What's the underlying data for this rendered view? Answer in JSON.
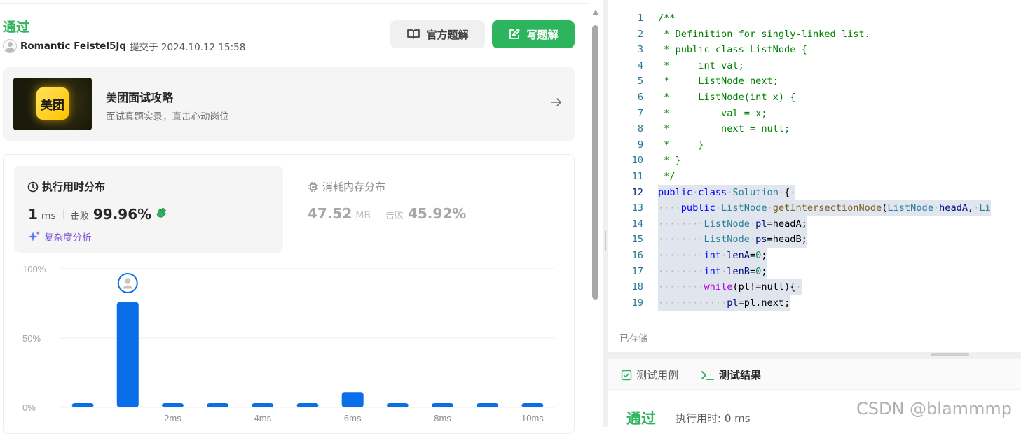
{
  "submission": {
    "status": "通过",
    "user_name": "Romantic Feistel5Jq",
    "submitted_at": "提交于 2024.10.12 15:58",
    "official_solution_label": "官方题解",
    "write_solution_label": "写题解"
  },
  "promo": {
    "logo_text": "美团",
    "title": "美团面试攻略",
    "subtitle": "面试真题实录，直击心动岗位"
  },
  "runtime": {
    "title": "执行用时分布",
    "value": "1",
    "unit": "ms",
    "beat_label": "击败",
    "beat_percent": "99.96%",
    "complexity_label": "复杂度分析"
  },
  "memory": {
    "title": "消耗内存分布",
    "value": "47.52",
    "unit": "MB",
    "beat_label": "击败",
    "beat_percent": "45.92%"
  },
  "chart_data": {
    "type": "bar",
    "categories": [
      "0ms",
      "1ms",
      "2ms",
      "3ms",
      "4ms",
      "5ms",
      "6ms",
      "7ms",
      "8ms",
      "9ms",
      "10ms"
    ],
    "values": [
      3,
      76,
      3,
      3,
      3,
      3,
      11,
      3,
      3,
      3,
      3
    ],
    "x_tick_labels": [
      "",
      "",
      "2ms",
      "",
      "4ms",
      "",
      "6ms",
      "",
      "8ms",
      "",
      "10ms"
    ],
    "y_tick_labels": [
      "0%",
      "50%",
      "100%"
    ],
    "ylim": [
      0,
      100
    ],
    "highlight_index": 1,
    "bar_color": "#0a6ee8",
    "grid": true
  },
  "editor": {
    "saved_label": "已存储",
    "lines": [
      {
        "n": "1",
        "t": [
          [
            "c-cm",
            "/**"
          ]
        ]
      },
      {
        "n": "2",
        "t": [
          [
            "c-cm",
            " * Definition for singly-linked list."
          ]
        ]
      },
      {
        "n": "3",
        "t": [
          [
            "c-cm",
            " * public class ListNode {"
          ]
        ]
      },
      {
        "n": "4",
        "t": [
          [
            "c-cm",
            " *     int val;"
          ]
        ]
      },
      {
        "n": "5",
        "t": [
          [
            "c-cm",
            " *     ListNode next;"
          ]
        ]
      },
      {
        "n": "6",
        "t": [
          [
            "c-cm",
            " *     ListNode(int x) {"
          ]
        ]
      },
      {
        "n": "7",
        "t": [
          [
            "c-cm",
            " *         val = x;"
          ]
        ]
      },
      {
        "n": "8",
        "t": [
          [
            "c-cm",
            " *         next = null;"
          ]
        ]
      },
      {
        "n": "9",
        "t": [
          [
            "c-cm",
            " *     }"
          ]
        ]
      },
      {
        "n": "10",
        "t": [
          [
            "c-cm",
            " * }"
          ]
        ]
      },
      {
        "n": "11",
        "t": [
          [
            "c-cm",
            " */"
          ]
        ]
      },
      {
        "n": "12",
        "sel": true,
        "cur": true,
        "t": [
          [
            "c-kw",
            "public"
          ],
          [
            "dots",
            "·"
          ],
          [
            "c-kw",
            "class"
          ],
          [
            "dots",
            "·"
          ],
          [
            "c-ty",
            "Solution"
          ],
          [
            "dots",
            "·"
          ],
          [
            "",
            "{"
          ],
          [
            "dots",
            "·"
          ]
        ]
      },
      {
        "n": "13",
        "sel": true,
        "t": [
          [
            "dots",
            "····"
          ],
          [
            "c-kw",
            "public"
          ],
          [
            "dots",
            "·"
          ],
          [
            "c-ty",
            "ListNode"
          ],
          [
            "dots",
            "·"
          ],
          [
            "c-fn",
            "getIntersectionNode"
          ],
          [
            "",
            "("
          ],
          [
            "c-ty",
            "ListNode"
          ],
          [
            "dots",
            "·"
          ],
          [
            "c-var",
            "headA"
          ],
          [
            "",
            ","
          ],
          [
            "dots",
            "·"
          ],
          [
            "c-ty",
            "Li"
          ]
        ]
      },
      {
        "n": "14",
        "sel": true,
        "t": [
          [
            "dots",
            "········"
          ],
          [
            "c-ty",
            "ListNode"
          ],
          [
            "dots",
            "·"
          ],
          [
            "c-var",
            "pl"
          ],
          [
            "",
            "=headA;"
          ]
        ]
      },
      {
        "n": "15",
        "sel": true,
        "t": [
          [
            "dots",
            "········"
          ],
          [
            "c-ty",
            "ListNode"
          ],
          [
            "dots",
            "·"
          ],
          [
            "c-var",
            "ps"
          ],
          [
            "",
            "=headB;"
          ]
        ]
      },
      {
        "n": "16",
        "sel": true,
        "t": [
          [
            "dots",
            "········"
          ],
          [
            "c-kw",
            "int"
          ],
          [
            "dots",
            "·"
          ],
          [
            "c-var",
            "lenA"
          ],
          [
            "",
            "="
          ],
          [
            "c-num",
            "0"
          ],
          [
            "",
            ";"
          ]
        ]
      },
      {
        "n": "17",
        "sel": true,
        "t": [
          [
            "dots",
            "········"
          ],
          [
            "c-kw",
            "int"
          ],
          [
            "dots",
            "·"
          ],
          [
            "c-var",
            "lenB"
          ],
          [
            "",
            "="
          ],
          [
            "c-num",
            "0"
          ],
          [
            "",
            ";"
          ]
        ]
      },
      {
        "n": "18",
        "sel": true,
        "t": [
          [
            "dots",
            "········"
          ],
          [
            "c-ctl",
            "while"
          ],
          [
            "",
            "(pl!=null){"
          ],
          [
            "dots",
            "·"
          ]
        ]
      },
      {
        "n": "19",
        "sel": true,
        "t": [
          [
            "dots",
            "············"
          ],
          [
            "c-var",
            "pl"
          ],
          [
            "",
            "=pl.next;"
          ]
        ]
      }
    ]
  },
  "result_panel": {
    "tab_testcase": "测试用例",
    "tab_result": "测试结果",
    "status": "通过",
    "runtime_text": "执行用时: 0 ms"
  },
  "watermark": "CSDN @blammmp",
  "colors": {
    "accepted": "#2db55d",
    "bar": "#0a6ee8",
    "complexity": "#7d59d6"
  }
}
